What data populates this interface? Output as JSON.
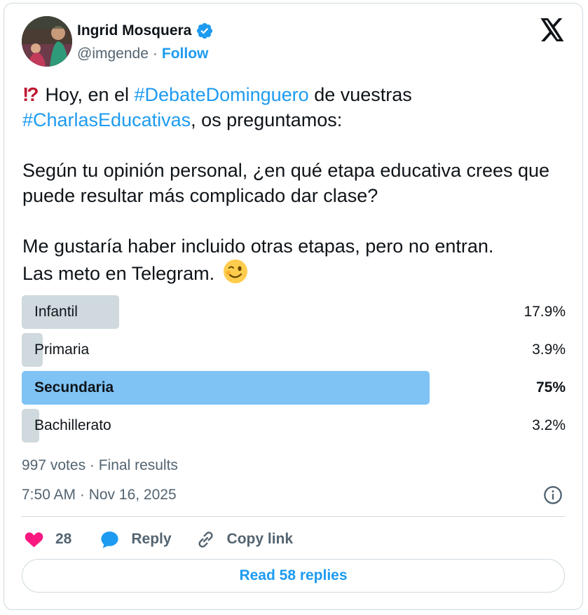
{
  "author": {
    "name": "Ingrid Mosquera",
    "handle": "@imgende",
    "separator": "·",
    "follow_label": "Follow",
    "verified_icon": "verified-badge-icon"
  },
  "tweet": {
    "lead_emoji": "⁉️",
    "line1_pre": "Hoy, en el ",
    "hashtag1": "#DebateDominguero",
    "line1_post": " de vuestras",
    "hashtag2": "#CharlasEducativas",
    "line2_post": ", os preguntamos:",
    "para2": "Según tu opinión personal, ¿en qué etapa educativa crees que puede resultar más complicado dar clase?",
    "para3_line1": "Me gustaría haber incluido otras etapas, pero no entran.",
    "para3_line2": "Las meto en Telegram.",
    "wink_emoji": "wink-emoji"
  },
  "poll": {
    "options": [
      {
        "label": "Infantil",
        "percent_text": "17.9%",
        "fraction": 0.179,
        "winner": false
      },
      {
        "label": "Primaria",
        "percent_text": "3.9%",
        "fraction": 0.039,
        "winner": false
      },
      {
        "label": "Secundaria",
        "percent_text": "75%",
        "fraction": 0.75,
        "winner": true
      },
      {
        "label": "Bachillerato",
        "percent_text": "3.2%",
        "fraction": 0.032,
        "winner": false
      }
    ],
    "summary": "997 votes · Final results"
  },
  "timestamp": "7:50 AM · Nov 16, 2025",
  "actions": {
    "like_count": "28",
    "reply_label": "Reply",
    "copy_label": "Copy link"
  },
  "read_replies_label": "Read 58 replies",
  "colors": {
    "accent": "#1d9bf0",
    "winner_bar": "#7ec3f4",
    "bar": "#cfd9de",
    "heart": "#f91880"
  }
}
